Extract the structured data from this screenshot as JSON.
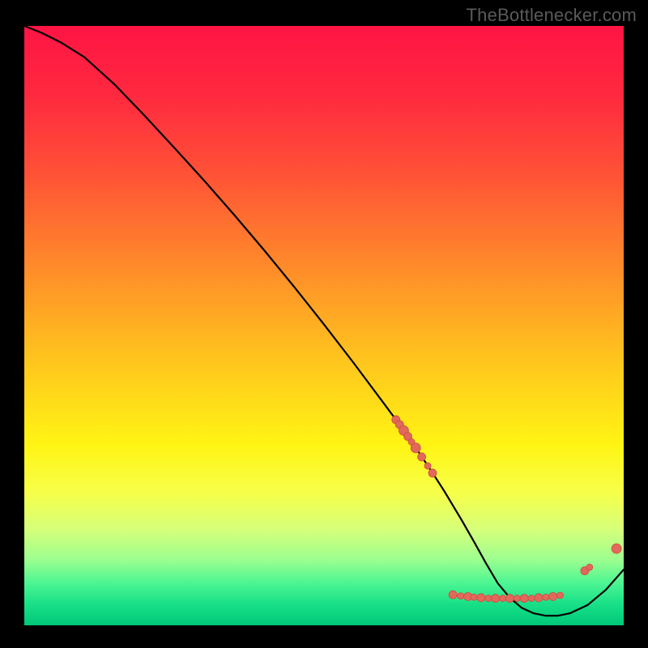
{
  "watermark": "TheBottlenecker.com",
  "colors": {
    "frame": "#000000",
    "line": "#000000",
    "dot_fill": "#e0695c",
    "dot_stroke": "#d14a3e",
    "gradient_stops": [
      {
        "offset": 0.0,
        "color": "#ff1444"
      },
      {
        "offset": 0.12,
        "color": "#ff2a3f"
      },
      {
        "offset": 0.25,
        "color": "#ff5336"
      },
      {
        "offset": 0.4,
        "color": "#ff8a2a"
      },
      {
        "offset": 0.55,
        "color": "#ffc21e"
      },
      {
        "offset": 0.7,
        "color": "#fff514"
      },
      {
        "offset": 0.78,
        "color": "#f6ff4a"
      },
      {
        "offset": 0.84,
        "color": "#d6ff7a"
      },
      {
        "offset": 0.89,
        "color": "#9dff8f"
      },
      {
        "offset": 0.93,
        "color": "#4bf592"
      },
      {
        "offset": 0.965,
        "color": "#18df87"
      },
      {
        "offset": 1.0,
        "color": "#00c878"
      }
    ]
  },
  "chart_data": {
    "type": "line",
    "title": "",
    "xlabel": "",
    "ylabel": "",
    "xlim": [
      0,
      100
    ],
    "ylim": [
      0,
      100
    ],
    "grid": false,
    "legend": false,
    "series": [
      {
        "name": "curve",
        "x": [
          0,
          3,
          6,
          10,
          15,
          20,
          25,
          30,
          35,
          40,
          45,
          50,
          55,
          60,
          62,
          65,
          68,
          70,
          73,
          75,
          77,
          79,
          81,
          83,
          85,
          87,
          89,
          91,
          94,
          97,
          100
        ],
        "y": [
          100,
          98.8,
          97.3,
          94.8,
          90.3,
          85.1,
          79.7,
          74.2,
          68.5,
          62.6,
          56.5,
          50.2,
          43.7,
          37.0,
          34.3,
          30.1,
          25.6,
          22.5,
          17.5,
          14.0,
          10.4,
          7.0,
          4.6,
          2.9,
          2.0,
          1.6,
          1.6,
          2.0,
          3.4,
          5.9,
          9.3
        ]
      }
    ],
    "highlight_points": {
      "name": "highlight-dots",
      "points": [
        {
          "x": 62.0,
          "y": 34.3,
          "r": 5
        },
        {
          "x": 62.6,
          "y": 33.5,
          "r": 5
        },
        {
          "x": 63.3,
          "y": 32.5,
          "r": 6
        },
        {
          "x": 64.0,
          "y": 31.5,
          "r": 5
        },
        {
          "x": 64.6,
          "y": 30.6,
          "r": 4
        },
        {
          "x": 65.3,
          "y": 29.6,
          "r": 6
        },
        {
          "x": 66.3,
          "y": 28.1,
          "r": 5
        },
        {
          "x": 67.3,
          "y": 26.6,
          "r": 4
        },
        {
          "x": 68.1,
          "y": 25.4,
          "r": 5
        },
        {
          "x": 71.5,
          "y": 5.1,
          "r": 5
        },
        {
          "x": 72.8,
          "y": 4.9,
          "r": 4
        },
        {
          "x": 74.0,
          "y": 4.8,
          "r": 5
        },
        {
          "x": 75.0,
          "y": 4.7,
          "r": 4
        },
        {
          "x": 76.2,
          "y": 4.6,
          "r": 5
        },
        {
          "x": 77.4,
          "y": 4.5,
          "r": 4
        },
        {
          "x": 78.6,
          "y": 4.5,
          "r": 5
        },
        {
          "x": 79.8,
          "y": 4.5,
          "r": 4
        },
        {
          "x": 81.0,
          "y": 4.5,
          "r": 5
        },
        {
          "x": 82.2,
          "y": 4.5,
          "r": 4
        },
        {
          "x": 83.4,
          "y": 4.5,
          "r": 5
        },
        {
          "x": 84.6,
          "y": 4.5,
          "r": 4
        },
        {
          "x": 85.8,
          "y": 4.6,
          "r": 5
        },
        {
          "x": 87.0,
          "y": 4.7,
          "r": 4
        },
        {
          "x": 88.2,
          "y": 4.8,
          "r": 5
        },
        {
          "x": 89.4,
          "y": 5.0,
          "r": 4
        },
        {
          "x": 93.5,
          "y": 9.1,
          "r": 5
        },
        {
          "x": 94.3,
          "y": 9.7,
          "r": 4
        },
        {
          "x": 98.8,
          "y": 12.8,
          "r": 6
        }
      ]
    }
  }
}
